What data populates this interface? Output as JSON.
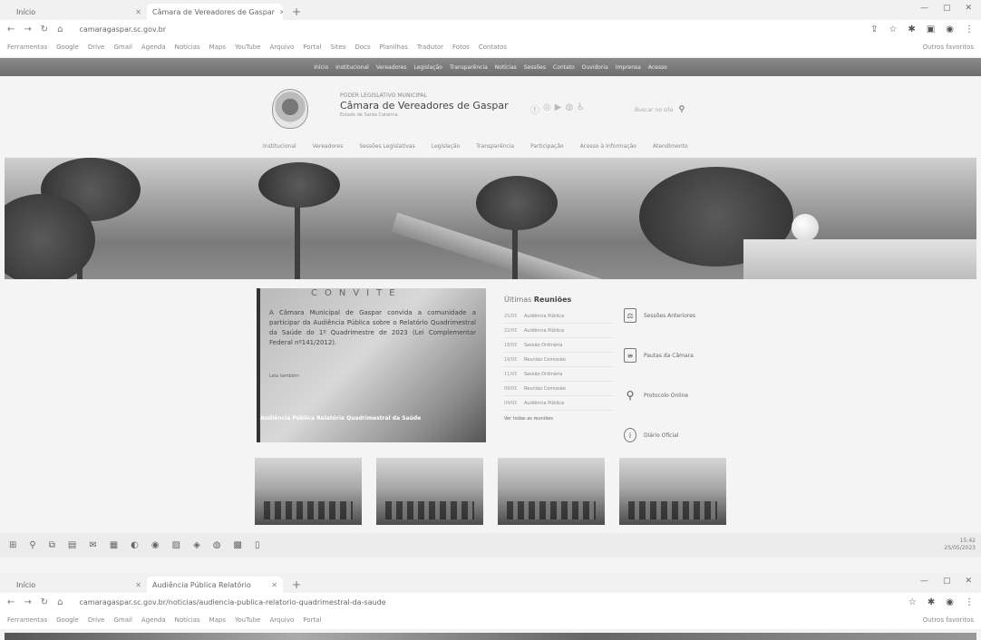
{
  "browser_top": {
    "tabs": [
      {
        "label": "Início",
        "active": false
      },
      {
        "label": "Câmara de Vereadores de Gaspar",
        "active": true
      }
    ],
    "url": "camaragaspar.sc.gov.br",
    "bookmarks": [
      "Ferramentas",
      "Google",
      "Drive",
      "Gmail",
      "Agenda",
      "Notícias",
      "Maps",
      "YouTube",
      "Arquivo",
      "Portal",
      "Sites",
      "Docs",
      "Planilhas",
      "Tradutor",
      "Fotos",
      "Contatos"
    ],
    "other_bookmarks": "Outros favoritos"
  },
  "site": {
    "topnav": [
      "Início",
      "Institucional",
      "Vereadores",
      "Legislação",
      "Transparência",
      "Notícias",
      "Sessões",
      "Contato",
      "Ouvidoria",
      "Imprensa",
      "Acesso"
    ],
    "brand_pre": "PODER LEGISLATIVO MUNICIPAL",
    "brand_name": "Câmara de Vereadores de Gaspar",
    "brand_sub": "Estado de Santa Catarina",
    "search_placeholder": "Buscar no site",
    "mainnav": [
      "Institucional",
      "Vereadores",
      "Sessões Legislativas",
      "Legislação",
      "Transparência",
      "Participação",
      "Acesso à Informação",
      "Atendimento"
    ],
    "news": {
      "heading": "CONVITE",
      "text": "A Câmara Municipal de Gaspar convida a comunidade a participar da Audiência Pública sobre o Relatório Quadrimestral da Saúde do 1º Quadrimestre de 2023 (Lei Complementar Federal nº141/2012).",
      "date": "Leia também",
      "caption": "Audiência Pública Relatório Quadrimestral da Saúde"
    },
    "meetings": {
      "title_pre": "Últimas",
      "title_bold": "Reuniões",
      "rows": [
        {
          "date": "25/05",
          "label": "Audiência Pública"
        },
        {
          "date": "22/05",
          "label": "Audiência Pública"
        },
        {
          "date": "18/05",
          "label": "Sessão Ordinária"
        },
        {
          "date": "16/05",
          "label": "Reunião Comissão"
        },
        {
          "date": "11/05",
          "label": "Sessão Ordinária"
        },
        {
          "date": "09/05",
          "label": "Reunião Comissão"
        },
        {
          "date": "04/05",
          "label": "Audiência Pública"
        }
      ],
      "all_link": "Ver todas as reuniões"
    },
    "quick_links": [
      {
        "label": "Sessões Anteriores",
        "icon": "gavel-icon"
      },
      {
        "label": "Pautas da Câmara",
        "icon": "document-icon"
      },
      {
        "label": "Protocolo Online",
        "icon": "search-icon"
      },
      {
        "label": "Diário Oficial",
        "icon": "info-icon"
      }
    ]
  },
  "taskbar": {
    "time": "15:42",
    "date": "25/05/2023"
  },
  "browser_bottom": {
    "tabs": [
      {
        "label": "Início",
        "active": false
      },
      {
        "label": "Audiência Pública Relatório",
        "active": true
      }
    ],
    "url": "camaragaspar.sc.gov.br/noticias/audiencia-publica-relatorio-quadrimestral-da-saude",
    "other_bookmarks": "Outros favoritos"
  }
}
